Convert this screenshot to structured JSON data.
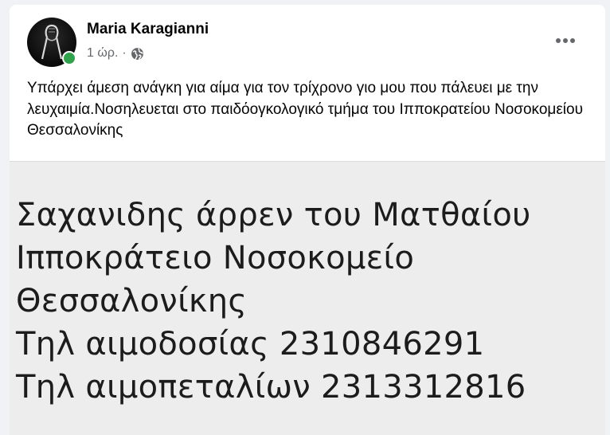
{
  "post": {
    "author": "Maria Karagianni",
    "timestamp": "1 ώρ.",
    "separator": "·",
    "audience_icon": "globe-icon",
    "more_icon": "more-horizontal-icon",
    "text": "Υπάρχει άμεση ανάγκη για αίμα για τον τρίχρονο γιο μου που πάλευει με την λευχαιμία.Νοσηλευεται στο παιδόογκολογικό τμήμα του Ιπποκρατείου Νοσοκομείου Θεσσαλονίκης",
    "image_text": {
      "line1": "Σαχανιδης άρρεν του Ματθαίου",
      "line2": "Ιπποκράτειο Νοσοκομείο",
      "line3": "Θεσσαλονίκης",
      "line4": "Τηλ αιμοδοσίας 2310846291",
      "line5": "Τηλ αιμοπεταλίων 2313312816"
    }
  },
  "colors": {
    "online_status": "#31a24c",
    "text_primary": "#050505",
    "text_secondary": "#65676b",
    "image_background": "#ededed"
  }
}
